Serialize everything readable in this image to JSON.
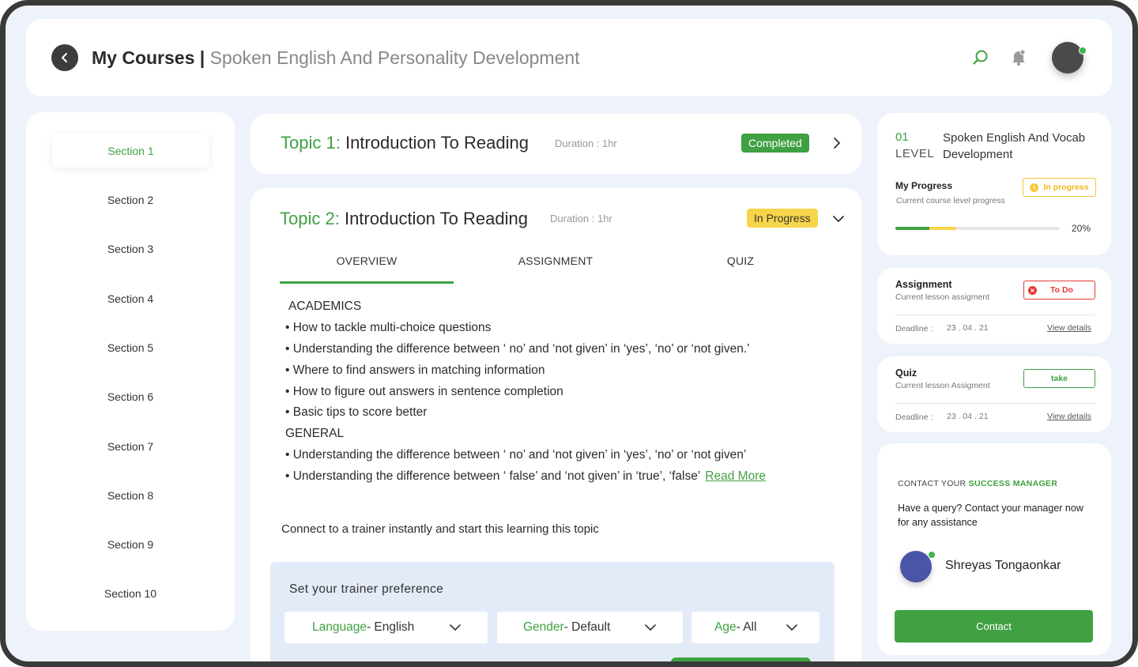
{
  "header": {
    "title": "My Courses",
    "separator": " | ",
    "course_name": "Spoken English And Personality Development",
    "icons": [
      "back-arrow-icon",
      "search-icon",
      "notification-bell-icon",
      "user-avatar"
    ]
  },
  "sidebar": {
    "items": [
      "Section 1",
      "Section 2",
      "Section 3",
      "Section 4",
      "Section 5",
      "Section 6",
      "Section 7",
      "Section 8",
      "Section 9",
      "Section 10"
    ],
    "active_index": 0
  },
  "topic1": {
    "number": "Topic 1:",
    "name": "Introduction To Reading",
    "duration": "Duration : 1hr",
    "status": "Completed"
  },
  "topic2": {
    "number": "Topic 2:",
    "name": "Introduction To Reading",
    "duration": "Duration : 1hr",
    "status": "In Progress",
    "tabs": [
      "OVERVIEW",
      "ASSIGNMENT",
      "QUIZ"
    ],
    "active_tab": 0,
    "overview": {
      "academics_heading": "ACADEMICS",
      "academics": [
        "• How to tackle multi-choice questions",
        "• Understanding the difference between ‘ no’ and ‘not given’ in ‘yes’, ‘no’ or ‘not given.’",
        "• Where to find answers in matching information",
        "• How to figure out answers in sentence completion",
        "• Basic tips to score better"
      ],
      "general_heading": "GENERAL",
      "general": [
        "• Understanding the difference between ‘ no’ and ‘not given’ in ‘yes’, ‘no’ or ‘not given’",
        "• Understanding the difference between ‘ false’ and ‘not given’ in ‘true’, ‘false’"
      ],
      "read_more": "Read More"
    },
    "connect_text": "Connect to a trainer instantly and start this learning this topic",
    "preference": {
      "title": "Set your trainer preference",
      "language_label": "Language",
      "language_value": "- English",
      "gender_label": "Gender",
      "gender_value": "- Default",
      "age_label": "Age",
      "age_value": "- All"
    }
  },
  "level": {
    "number": "01",
    "label": "LEVEL",
    "course": "Spoken English And Vocab Development",
    "progress_title": "My Progress",
    "progress_sub": "Current course level progress",
    "status": "In progress",
    "percent_text": "20%",
    "progress_fraction": 0.2
  },
  "assignment": {
    "title": "Assignment",
    "subtitle": "Current lesson assigment",
    "status": "To Do",
    "deadline_label": "Deadline :",
    "deadline": "23 . 04 . 21",
    "link": "View details"
  },
  "quiz": {
    "title": "Quiz",
    "subtitle": "Current lesson Assigment",
    "action": "take",
    "deadline_label": "Deadline :",
    "deadline": "23 . 04 . 21",
    "link": "View details"
  },
  "contact": {
    "heading_plain": "CONTACT YOUR ",
    "heading_highlight": "SUCCESS MANAGER",
    "message": "Have a query? Contact your manager now for any assistance",
    "manager_name": "Shreyas Tongaonkar",
    "button": "Contact"
  },
  "colors": {
    "accent_green": "#3fa142",
    "progress_yellow": "#f7d54a",
    "todo_red": "#e53935",
    "background": "#eef2fa"
  }
}
